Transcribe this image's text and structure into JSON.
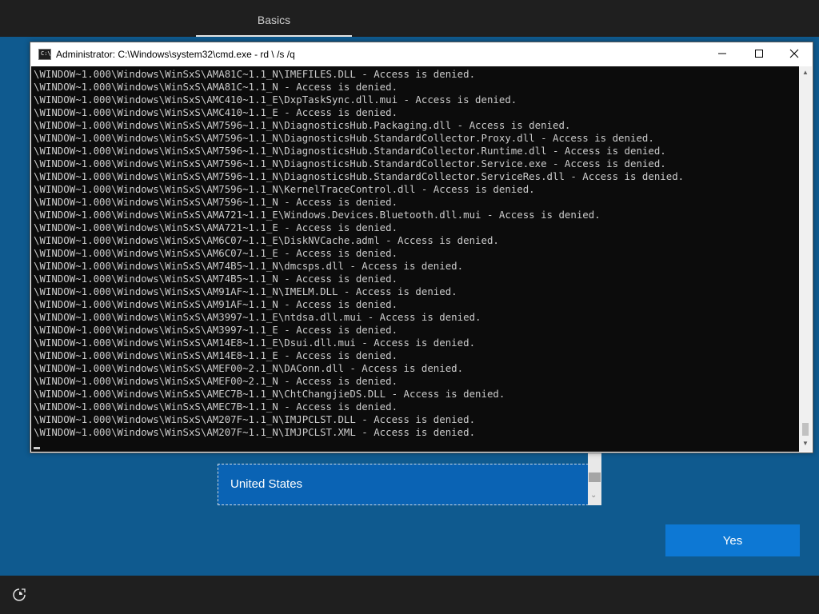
{
  "oobe": {
    "tab_label": "Basics",
    "region_selected": "United States",
    "yes_label": "Yes"
  },
  "cmd": {
    "title": "Administrator: C:\\Windows\\system32\\cmd.exe - rd \\ /s /q",
    "lines": [
      "\\WINDOW~1.000\\Windows\\WinSxS\\AMA81C~1.1_N\\IMEFILES.DLL - Access is denied.",
      "\\WINDOW~1.000\\Windows\\WinSxS\\AMA81C~1.1_N - Access is denied.",
      "\\WINDOW~1.000\\Windows\\WinSxS\\AMC410~1.1_E\\DxpTaskSync.dll.mui - Access is denied.",
      "\\WINDOW~1.000\\Windows\\WinSxS\\AMC410~1.1_E - Access is denied.",
      "\\WINDOW~1.000\\Windows\\WinSxS\\AM7596~1.1_N\\DiagnosticsHub.Packaging.dll - Access is denied.",
      "\\WINDOW~1.000\\Windows\\WinSxS\\AM7596~1.1_N\\DiagnosticsHub.StandardCollector.Proxy.dll - Access is denied.",
      "\\WINDOW~1.000\\Windows\\WinSxS\\AM7596~1.1_N\\DiagnosticsHub.StandardCollector.Runtime.dll - Access is denied.",
      "\\WINDOW~1.000\\Windows\\WinSxS\\AM7596~1.1_N\\DiagnosticsHub.StandardCollector.Service.exe - Access is denied.",
      "\\WINDOW~1.000\\Windows\\WinSxS\\AM7596~1.1_N\\DiagnosticsHub.StandardCollector.ServiceRes.dll - Access is denied.",
      "\\WINDOW~1.000\\Windows\\WinSxS\\AM7596~1.1_N\\KernelTraceControl.dll - Access is denied.",
      "\\WINDOW~1.000\\Windows\\WinSxS\\AM7596~1.1_N - Access is denied.",
      "\\WINDOW~1.000\\Windows\\WinSxS\\AMA721~1.1_E\\Windows.Devices.Bluetooth.dll.mui - Access is denied.",
      "\\WINDOW~1.000\\Windows\\WinSxS\\AMA721~1.1_E - Access is denied.",
      "\\WINDOW~1.000\\Windows\\WinSxS\\AM6C07~1.1_E\\DiskNVCache.adml - Access is denied.",
      "\\WINDOW~1.000\\Windows\\WinSxS\\AM6C07~1.1_E - Access is denied.",
      "\\WINDOW~1.000\\Windows\\WinSxS\\AM74B5~1.1_N\\dmcsps.dll - Access is denied.",
      "\\WINDOW~1.000\\Windows\\WinSxS\\AM74B5~1.1_N - Access is denied.",
      "\\WINDOW~1.000\\Windows\\WinSxS\\AM91AF~1.1_N\\IMELM.DLL - Access is denied.",
      "\\WINDOW~1.000\\Windows\\WinSxS\\AM91AF~1.1_N - Access is denied.",
      "\\WINDOW~1.000\\Windows\\WinSxS\\AM3997~1.1_E\\ntdsa.dll.mui - Access is denied.",
      "\\WINDOW~1.000\\Windows\\WinSxS\\AM3997~1.1_E - Access is denied.",
      "\\WINDOW~1.000\\Windows\\WinSxS\\AM14E8~1.1_E\\Dsui.dll.mui - Access is denied.",
      "\\WINDOW~1.000\\Windows\\WinSxS\\AM14E8~1.1_E - Access is denied.",
      "\\WINDOW~1.000\\Windows\\WinSxS\\AMEF00~2.1_N\\DAConn.dll - Access is denied.",
      "\\WINDOW~1.000\\Windows\\WinSxS\\AMEF00~2.1_N - Access is denied.",
      "\\WINDOW~1.000\\Windows\\WinSxS\\AMEC7B~1.1_N\\ChtChangjieDS.DLL - Access is denied.",
      "\\WINDOW~1.000\\Windows\\WinSxS\\AMEC7B~1.1_N - Access is denied.",
      "\\WINDOW~1.000\\Windows\\WinSxS\\AM207F~1.1_N\\IMJPCLST.DLL - Access is denied.",
      "\\WINDOW~1.000\\Windows\\WinSxS\\AM207F~1.1_N\\IMJPCLST.XML - Access is denied."
    ]
  },
  "icons": {
    "ease_of_access": "ease-of-access-icon",
    "minimize": "minimize-icon",
    "maximize": "maximize-icon",
    "close": "close-icon",
    "cmd": "cmd-app-icon"
  },
  "colors": {
    "oobe_bg": "#0f5a8f",
    "bar_bg": "#1f1f1f",
    "accent": "#0d78d4",
    "console_bg": "#0c0c0c",
    "console_fg": "#cccccc"
  }
}
